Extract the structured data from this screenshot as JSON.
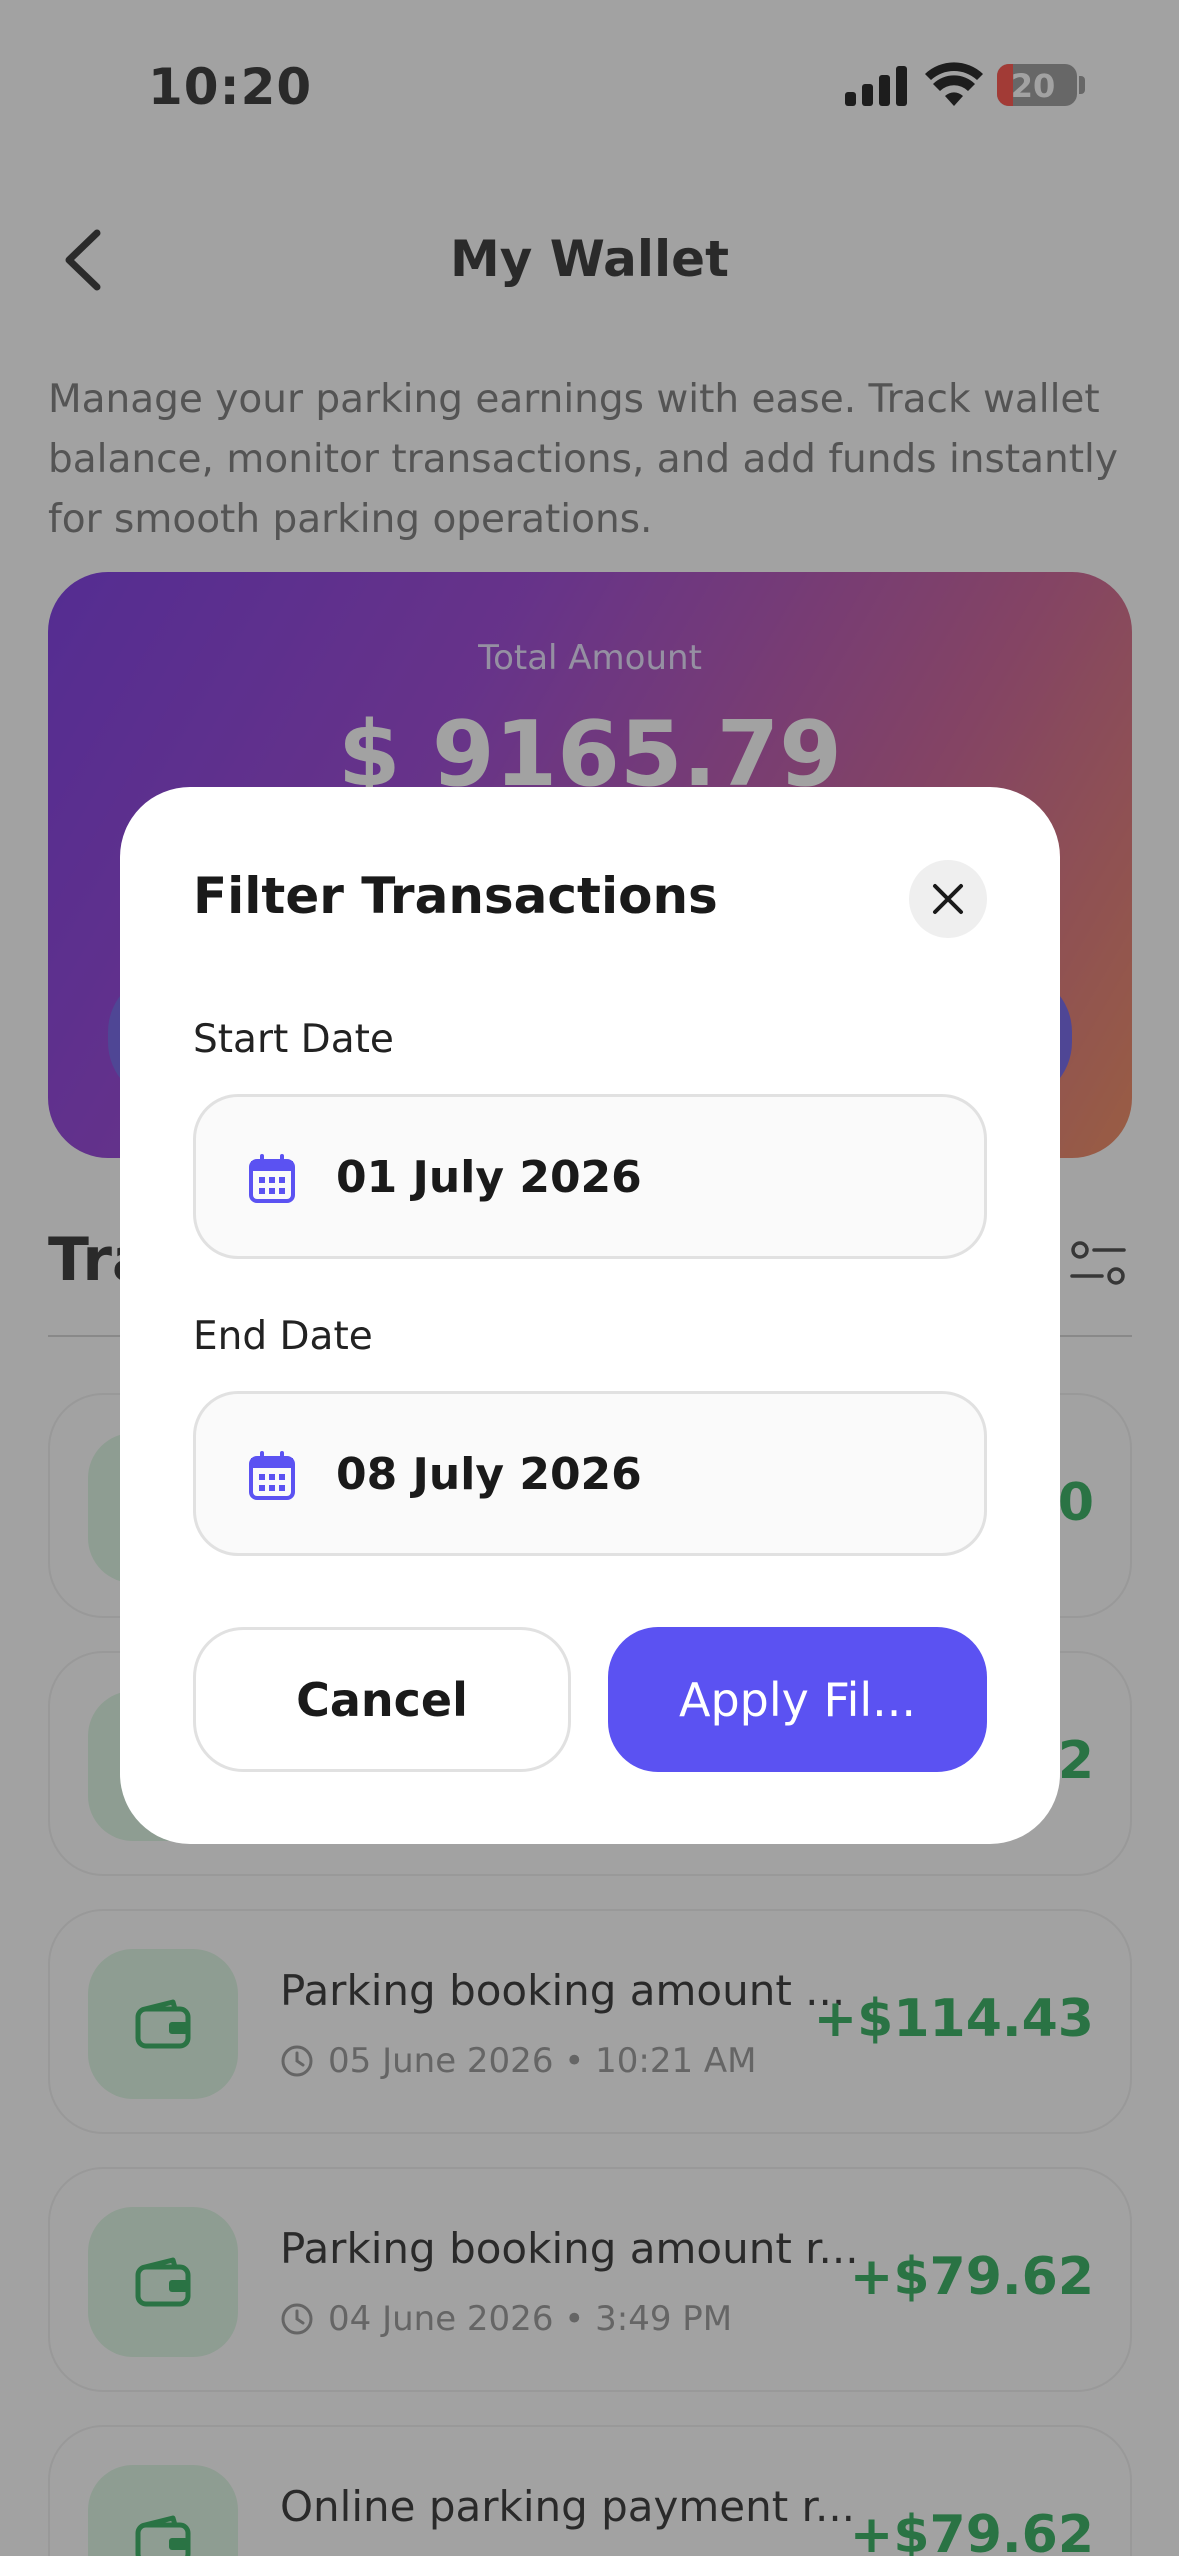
{
  "status_bar": {
    "time": "10:20",
    "battery": "20"
  },
  "header": {
    "title": "My Wallet"
  },
  "description": "Manage your parking earnings with ease. Track wallet balance, monitor transactions, and add funds instantly for smooth parking operations.",
  "wallet": {
    "label": "Total Amount",
    "amount": "$ 9165.79"
  },
  "transactions": {
    "title": "Tra",
    "items": [
      {
        "title": "",
        "date": "",
        "amount": "0"
      },
      {
        "title": "",
        "date": "",
        "amount": "2"
      },
      {
        "title": "Parking booking amount ...",
        "date": "05 June 2026 • 10:21 AM",
        "amount": "+$114.43"
      },
      {
        "title": "Parking booking amount r...",
        "date": "04 June 2026 • 3:49 PM",
        "amount": "+$79.62"
      },
      {
        "title": "Online parking payment r...",
        "date": "",
        "amount": "+$79.62"
      }
    ]
  },
  "modal": {
    "title": "Filter Transactions",
    "start_label": "Start Date",
    "start_value": "01 July 2026",
    "end_label": "End Date",
    "end_value": "08 July 2026",
    "cancel_label": "Cancel",
    "apply_label": "Apply Fil..."
  },
  "colors": {
    "accent": "#5b52f2",
    "positive": "#1aa64b",
    "icon_bg": "#d9f5e0"
  }
}
